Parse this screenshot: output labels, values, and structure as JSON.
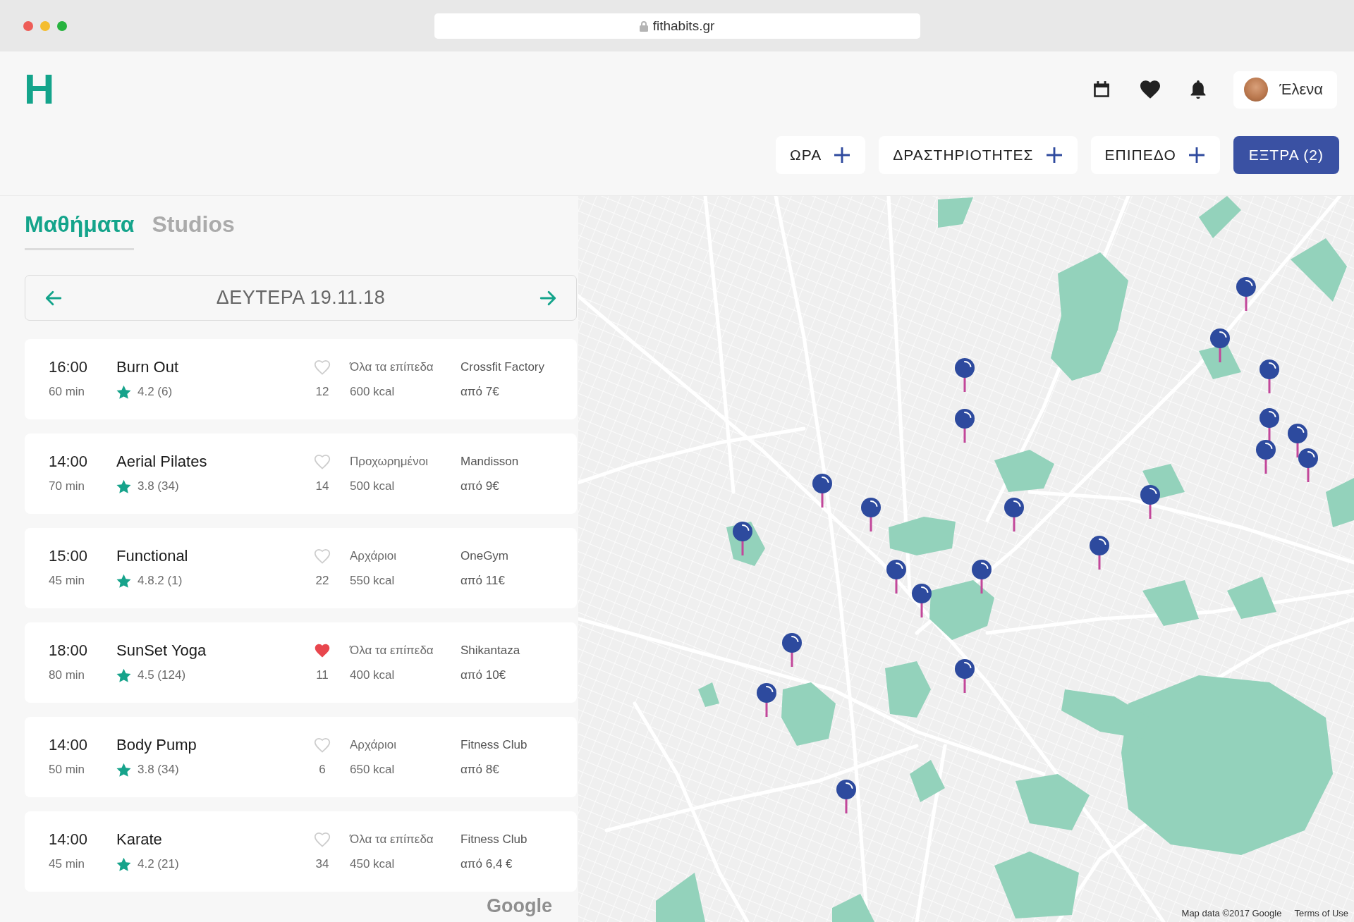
{
  "browser": {
    "url": "fithabits.gr"
  },
  "header": {
    "logo": "H",
    "user": {
      "name": "Έλενα"
    }
  },
  "filters": [
    {
      "label": "ΩΡΑ",
      "active": false
    },
    {
      "label": "ΔΡΑΣΤΗΡΙΟΤΗΤΕΣ",
      "active": false
    },
    {
      "label": "ΕΠΙΠΕΔΟ",
      "active": false
    },
    {
      "label": "ΕΞΤΡΑ (2)",
      "active": true
    }
  ],
  "tabs": [
    {
      "label": "Μαθήματα",
      "selected": true
    },
    {
      "label": "Studios",
      "selected": false
    }
  ],
  "date_nav": {
    "date": "ΔΕΥΤΕΡΑ 19.11.18"
  },
  "classes": [
    {
      "time": "16:00",
      "duration": "60 min",
      "name": "Burn Out",
      "rating": "4.2 (6)",
      "favorite": false,
      "likes": "12",
      "level": "Όλα τα επίπεδα",
      "calories": "600 kcal",
      "studio": "Crossfit Factory",
      "price": "από 7€"
    },
    {
      "time": "14:00",
      "duration": "70 min",
      "name": "Aerial Pilates",
      "rating": "3.8 (34)",
      "favorite": false,
      "likes": "14",
      "level": "Προχωρημένοι",
      "calories": "500 kcal",
      "studio": "Mandisson",
      "price": "από 9€"
    },
    {
      "time": "15:00",
      "duration": "45 min",
      "name": "Functional",
      "rating": "4.8.2 (1)",
      "favorite": false,
      "likes": "22",
      "level": "Αρχάριοι",
      "calories": "550 kcal",
      "studio": "OneGym",
      "price": "από 11€"
    },
    {
      "time": "18:00",
      "duration": "80 min",
      "name": "SunSet Yoga",
      "rating": "4.5 (124)",
      "favorite": true,
      "likes": "11",
      "level": "Όλα τα επίπεδα",
      "calories": "400 kcal",
      "studio": "Shikantaza",
      "price": "από 10€"
    },
    {
      "time": "14:00",
      "duration": "50 min",
      "name": "Body Pump",
      "rating": "3.8 (34)",
      "favorite": false,
      "likes": "6",
      "level": "Αρχάριοι",
      "calories": "650 kcal",
      "studio": "Fitness Club",
      "price": "από 8€"
    },
    {
      "time": "14:00",
      "duration": "45 min",
      "name": "Karate",
      "rating": "4.2 (21)",
      "favorite": false,
      "likes": "34",
      "level": "Όλα τα επίπεδα",
      "calories": "450 kcal",
      "studio": "Fitness Club",
      "price": "από 6,4 €"
    }
  ],
  "map": {
    "logo": "Google",
    "attribution": "Map data ©2017 Google",
    "terms": "Terms of Use"
  }
}
